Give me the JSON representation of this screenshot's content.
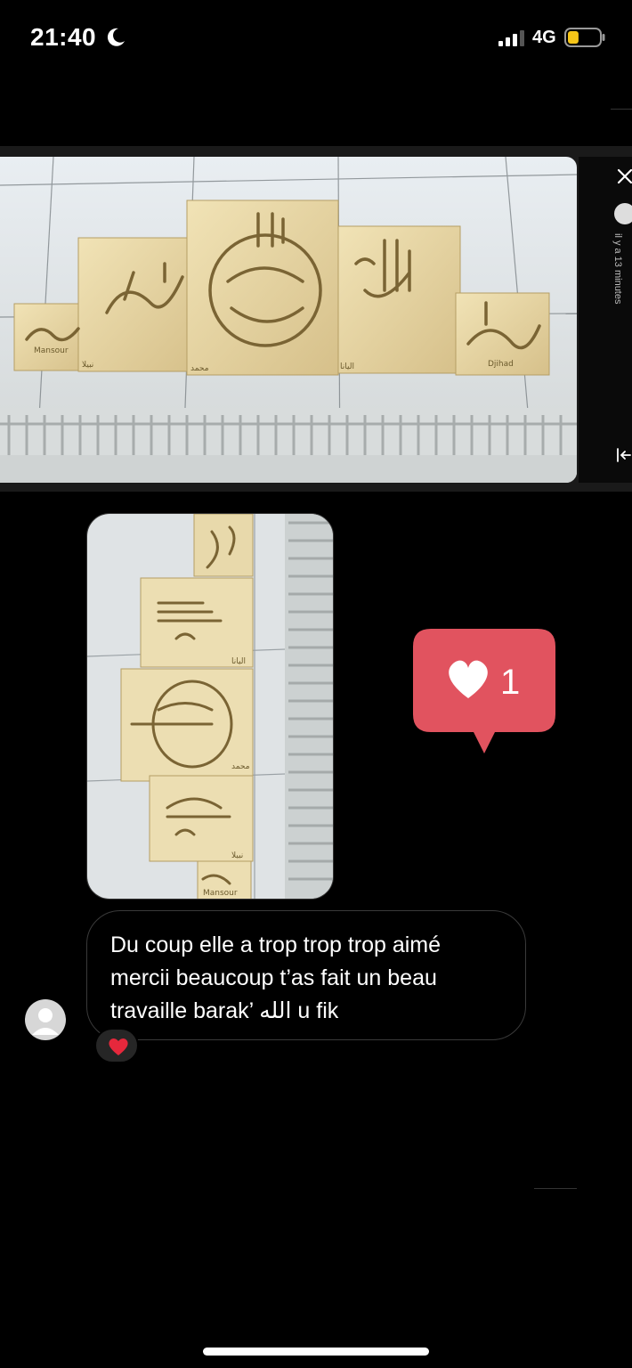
{
  "status_bar": {
    "time": "21:40",
    "network": "4G",
    "battery_level": 0.35,
    "battery_color": "#f5c518"
  },
  "story": {
    "meta": "il y a 13 minutes",
    "icons": [
      "close-icon",
      "collapse-icon"
    ],
    "panel_labels": [
      "Mansour",
      "نبيلا",
      "محمد",
      "اليانا",
      "Djihad"
    ]
  },
  "reply_photo": {
    "panel_labels": [
      "اليانا",
      "محمد",
      "نبيلا",
      "Mansour"
    ]
  },
  "like_notification": {
    "count": "1",
    "color": "#e1535f"
  },
  "message": {
    "text": "Du coup elle a trop trop trop aimé mercii beaucoup t’as fait un beau travaille barak’ الله u fik",
    "reaction": "❤️"
  }
}
